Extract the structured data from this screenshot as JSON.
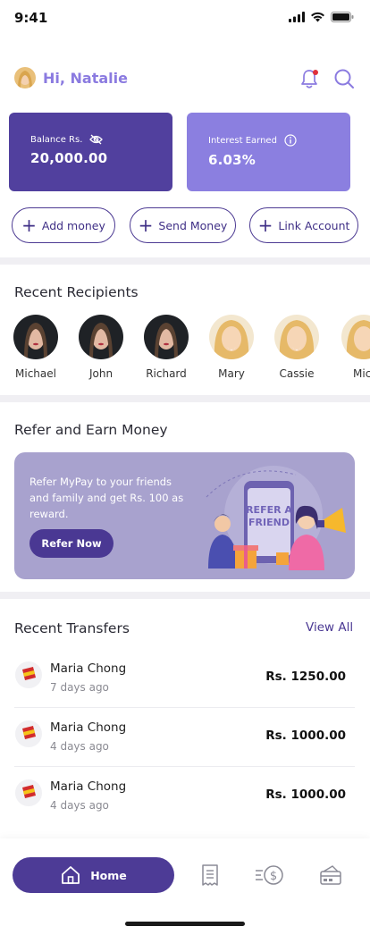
{
  "status_bar": {
    "time": "9:41"
  },
  "header": {
    "greeting": "Hi, Natalie"
  },
  "cards": {
    "balance": {
      "label": "Balance Rs.",
      "value": "20,000.00"
    },
    "interest": {
      "label": "Interest Earned",
      "value": "6.03%"
    }
  },
  "actions": {
    "add": "Add money",
    "send": "Send Money",
    "link": "Link Account"
  },
  "recipients": {
    "title": "Recent Recipients",
    "items": [
      {
        "name": "Michael"
      },
      {
        "name": "John"
      },
      {
        "name": "Richard"
      },
      {
        "name": "Mary"
      },
      {
        "name": "Cassie"
      },
      {
        "name": "Mic"
      }
    ]
  },
  "refer": {
    "title": "Refer and Earn Money",
    "text": "Refer MyPay to your friends and family and get Rs. 100 as reward.",
    "button": "Refer Now",
    "illustration_text_1": "REFER A",
    "illustration_text_2": "FRIEND"
  },
  "transfers": {
    "title": "Recent Transfers",
    "view_all": "View All",
    "items": [
      {
        "name": "Maria Chong",
        "date": "7 days ago",
        "amount": "Rs. 1250.00"
      },
      {
        "name": "Maria Chong",
        "date": "4 days ago",
        "amount": "Rs. 1000.00"
      },
      {
        "name": "Maria Chong",
        "date": "4 days ago",
        "amount": "Rs. 1000.00"
      }
    ]
  },
  "nav": {
    "home": "Home"
  },
  "colors": {
    "primary": "#4d3b96",
    "accent": "#8b7be0",
    "card_primary": "#51409e",
    "card_secondary": "#8b7fe0",
    "banner": "#a8a2ce"
  }
}
